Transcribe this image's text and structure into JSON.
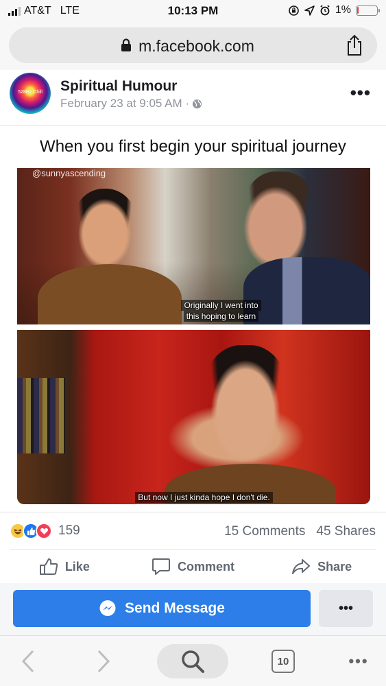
{
  "status_bar": {
    "carrier": "AT&T",
    "network": "LTE",
    "time": "10:13 PM",
    "battery_percent": "1%",
    "battery_level": 0.01,
    "icons": [
      "signal-icon",
      "screen-lock-icon",
      "location-icon",
      "alarm-icon",
      "battery-icon"
    ]
  },
  "browser": {
    "url": "m.facebook.com",
    "tab_count": "10"
  },
  "post": {
    "page_name": "Spiritual Humour",
    "timestamp": "February 23 at 9:05 AM ·",
    "avatar_text": "528Hz Chill",
    "meme_title": "When you first begin your spiritual journey",
    "watermark": "@sunnyascending",
    "caption_top_line1": "Originally I went into",
    "caption_top_line2": "this hoping to learn",
    "caption_bottom": "But now I just kinda hope I don't die."
  },
  "engagement": {
    "reaction_count": "159",
    "comments": "15 Comments",
    "shares": "45 Shares"
  },
  "actions": {
    "like": "Like",
    "comment": "Comment",
    "share": "Share"
  },
  "message_bar": {
    "send_label": "Send Message",
    "more_label": "•••"
  },
  "colors": {
    "facebook_blue": "#2d7ee8",
    "like_blue": "#1a78f2",
    "love_red": "#f33e58",
    "haha_yellow": "#f7c843"
  }
}
